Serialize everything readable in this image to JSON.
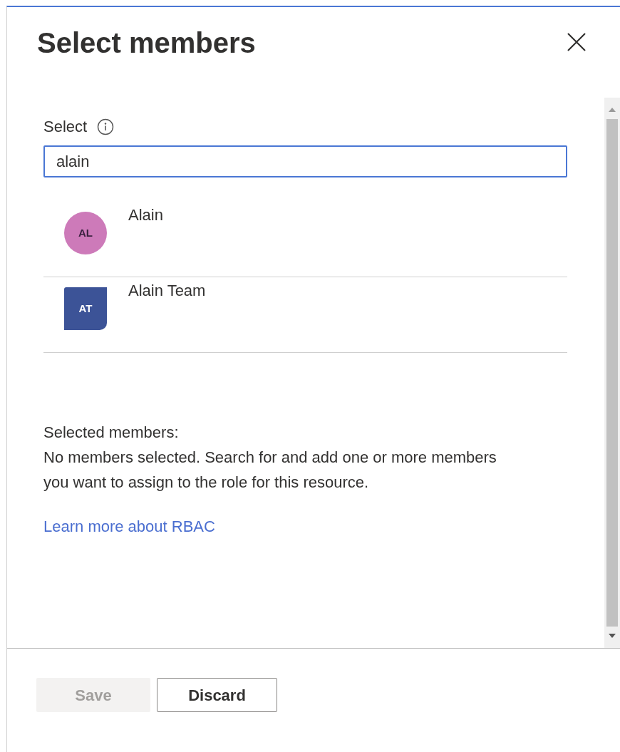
{
  "title": "Select members",
  "select": {
    "label": "Select",
    "value": "alain"
  },
  "results": [
    {
      "kind": "user",
      "initials": "AL",
      "name": "Alain",
      "color": "#cd7ab9"
    },
    {
      "kind": "group",
      "initials": "AT",
      "name": "Alain Team",
      "color": "#3c5397"
    }
  ],
  "selected_members": {
    "heading": "Selected members:",
    "message": "No members selected. Search for and add one or more members you want to assign to the role for this resource."
  },
  "link": "Learn more about RBAC",
  "buttons": [
    {
      "label": "Save",
      "disabled": true
    },
    {
      "label": "Discard",
      "disabled": false
    }
  ]
}
